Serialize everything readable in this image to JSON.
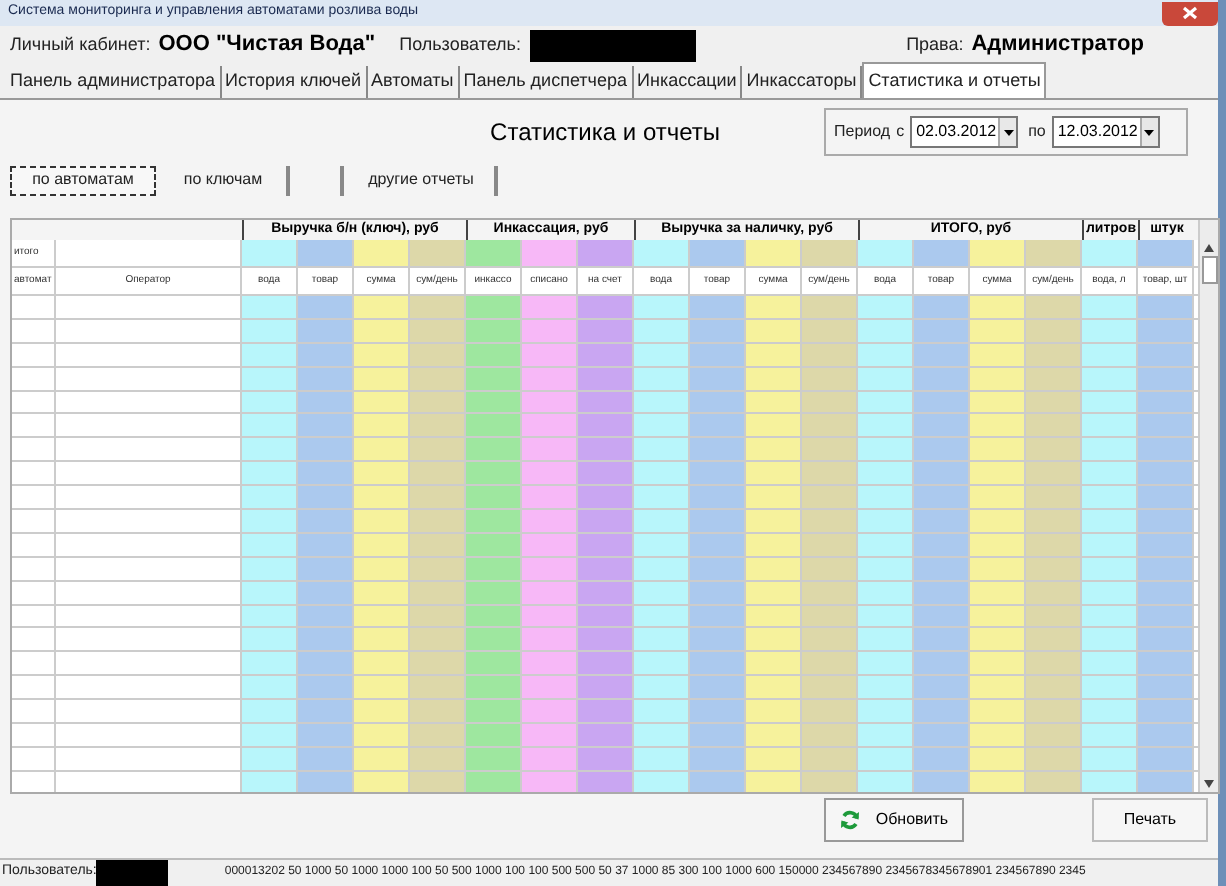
{
  "window": {
    "title": "Система мониторинга и управления автоматами розлива воды"
  },
  "header": {
    "cabinet_label": "Личный кабинет:",
    "company": "ООО \"Чистая Вода\"",
    "user_label": "Пользователь:",
    "rights_label": "Права:",
    "rights": "Администратор"
  },
  "tabs": [
    {
      "label": "Панель администратора",
      "selected": false
    },
    {
      "label": "История ключей",
      "selected": false
    },
    {
      "label": "Автоматы",
      "selected": false
    },
    {
      "label": "Панель диспетчера",
      "selected": false
    },
    {
      "label": "Инкассации",
      "selected": false
    },
    {
      "label": "Инкассаторы",
      "selected": false
    },
    {
      "label": "Статистика и отчеты",
      "selected": true
    }
  ],
  "page_title": "Статистика и отчеты",
  "period": {
    "label": "Период",
    "from_label": "с",
    "from": "02.03.2012",
    "to_label": "по",
    "to": "12.03.2012"
  },
  "subtabs": [
    {
      "label": "по автоматам",
      "selected": true
    },
    {
      "label": "по ключам",
      "selected": false
    },
    {
      "selected": false
    },
    {
      "label": "другие отчеты",
      "selected": false
    }
  ],
  "table": {
    "groups": [
      {
        "label": "Выручка б/н (ключ), руб"
      },
      {
        "label": "Инкассация, руб"
      },
      {
        "label": "Выручка за наличку, руб"
      },
      {
        "label": "ИТОГО, руб"
      },
      {
        "label": "литров"
      },
      {
        "label": "штук"
      }
    ],
    "total_label": "итого",
    "fixed_columns": [
      "автомат",
      "Оператор"
    ],
    "columns": [
      {
        "label": "вода",
        "color": "#b8f6fb"
      },
      {
        "label": "товар",
        "color": "#abc9ee"
      },
      {
        "label": "сумма",
        "color": "#f6f29c"
      },
      {
        "label": "сум/день",
        "color": "#ddd8a9"
      },
      {
        "label": "инкассо",
        "color": "#9ee79f"
      },
      {
        "label": "списано",
        "color": "#f7b8f7"
      },
      {
        "label": "на счет",
        "color": "#c9a6f2"
      },
      {
        "label": "вода",
        "color": "#b8f6fb"
      },
      {
        "label": "товар",
        "color": "#abc9ee"
      },
      {
        "label": "сумма",
        "color": "#f6f29c"
      },
      {
        "label": "сум/день",
        "color": "#ddd8a9"
      },
      {
        "label": "вода",
        "color": "#b8f6fb"
      },
      {
        "label": "товар",
        "color": "#abc9ee"
      },
      {
        "label": "сумма",
        "color": "#f6f29c"
      },
      {
        "label": "сум/день",
        "color": "#ddd8a9"
      },
      {
        "label": "вода, л",
        "color": "#b8f6fb"
      },
      {
        "label": "товар, шт",
        "color": "#abc9ee"
      }
    ]
  },
  "buttons": {
    "refresh": "Обновить",
    "print": "Печать"
  },
  "status_bar": {
    "user_label": "Пользователь:",
    "values": "000013202  50 1000  50 1000 1000  100  50  500 1000  100  100  500  500  50  37  1000 85  300  100 1000  600 150000 234567890 2345678345678901 234567890 2345"
  }
}
